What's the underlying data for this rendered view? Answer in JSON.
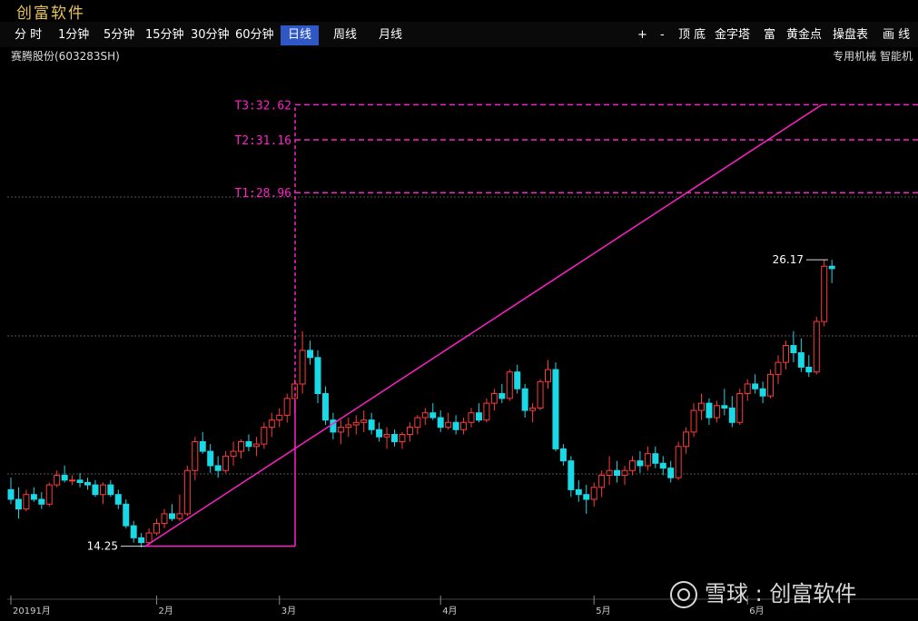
{
  "app": {
    "title": "创富软件"
  },
  "toolbar": {
    "periods": [
      "分 时",
      "1分钟",
      "5分钟",
      "15分钟",
      "30分钟",
      "60分钟",
      "日线",
      "周线",
      "月线"
    ],
    "active": "日线",
    "tools": [
      "+",
      "-",
      "顶 底",
      "金字塔",
      "富",
      "黄金点",
      "操盘表",
      "画 线"
    ]
  },
  "stock": {
    "name": "赛腾股份(603283SH)",
    "sector": "专用机械    智能机"
  },
  "colors": {
    "up": "#ff3b3b",
    "down": "#19d9e6",
    "target": "#ff20c8",
    "grid": "#555555"
  },
  "chart_data": {
    "type": "candlestick",
    "ylim": [
      12.8,
      33.2
    ],
    "low_label": "14.25",
    "last_label": "26.17",
    "targets": [
      {
        "label": "T3:32.62",
        "value": 32.62
      },
      {
        "label": "T2:31.16",
        "value": 31.16
      },
      {
        "label": "T1:28.96",
        "value": 28.96
      }
    ],
    "x_ticks": [
      {
        "label": "20191月",
        "index": 0
      },
      {
        "label": "2月",
        "index": 19
      },
      {
        "label": "3月",
        "index": 35
      },
      {
        "label": "4月",
        "index": 56
      },
      {
        "label": "5月",
        "index": 76
      },
      {
        "label": "6月",
        "index": 96
      }
    ],
    "ohlc": [
      [
        16.6,
        17.1,
        16.0,
        16.2
      ],
      [
        16.2,
        16.7,
        15.4,
        15.8
      ],
      [
        15.8,
        16.6,
        15.7,
        16.4
      ],
      [
        16.4,
        16.7,
        16.1,
        16.2
      ],
      [
        16.2,
        16.5,
        15.8,
        16.0
      ],
      [
        16.0,
        16.9,
        15.9,
        16.8
      ],
      [
        16.8,
        17.4,
        16.7,
        17.2
      ],
      [
        17.2,
        17.6,
        16.9,
        17.0
      ],
      [
        17.0,
        17.2,
        16.8,
        17.0
      ],
      [
        17.0,
        17.3,
        16.7,
        16.9
      ],
      [
        16.9,
        17.1,
        16.6,
        16.8
      ],
      [
        16.8,
        17.0,
        16.3,
        16.4
      ],
      [
        16.4,
        16.9,
        16.0,
        16.8
      ],
      [
        16.8,
        17.0,
        16.3,
        16.4
      ],
      [
        16.4,
        16.6,
        15.8,
        16.0
      ],
      [
        16.0,
        16.2,
        15.0,
        15.1
      ],
      [
        15.1,
        15.3,
        14.4,
        14.6
      ],
      [
        14.6,
        14.8,
        14.2,
        14.4
      ],
      [
        14.4,
        15.0,
        14.3,
        14.8
      ],
      [
        14.8,
        15.4,
        14.7,
        15.2
      ],
      [
        15.2,
        15.8,
        15.0,
        15.6
      ],
      [
        15.6,
        16.0,
        15.3,
        15.4
      ],
      [
        15.4,
        16.4,
        15.3,
        15.6
      ],
      [
        15.6,
        17.6,
        15.5,
        17.4
      ],
      [
        17.4,
        18.8,
        17.0,
        18.6
      ],
      [
        18.6,
        19.0,
        18.1,
        18.2
      ],
      [
        18.2,
        18.5,
        17.3,
        17.6
      ],
      [
        17.6,
        18.0,
        17.1,
        17.4
      ],
      [
        17.4,
        18.2,
        17.3,
        18.0
      ],
      [
        18.0,
        18.6,
        17.6,
        18.2
      ],
      [
        18.2,
        18.7,
        17.9,
        18.6
      ],
      [
        18.6,
        18.9,
        18.2,
        18.4
      ],
      [
        18.4,
        18.8,
        18.0,
        18.5
      ],
      [
        18.5,
        19.4,
        18.3,
        19.2
      ],
      [
        19.2,
        19.8,
        18.8,
        19.5
      ],
      [
        19.5,
        20.0,
        19.2,
        19.7
      ],
      [
        19.7,
        20.6,
        19.4,
        20.4
      ],
      [
        20.4,
        21.2,
        19.8,
        21.0
      ],
      [
        21.0,
        23.2,
        20.6,
        22.4
      ],
      [
        22.4,
        22.8,
        21.8,
        22.1
      ],
      [
        22.1,
        22.4,
        20.2,
        20.6
      ],
      [
        20.6,
        20.9,
        19.3,
        19.5
      ],
      [
        19.5,
        19.8,
        18.7,
        19.0
      ],
      [
        19.0,
        19.5,
        18.5,
        19.2
      ],
      [
        19.2,
        19.6,
        18.8,
        19.3
      ],
      [
        19.3,
        19.7,
        18.9,
        19.4
      ],
      [
        19.4,
        19.9,
        19.0,
        19.5
      ],
      [
        19.5,
        19.8,
        18.9,
        19.1
      ],
      [
        19.1,
        19.4,
        18.6,
        18.8
      ],
      [
        18.8,
        19.2,
        18.3,
        18.9
      ],
      [
        18.9,
        19.1,
        18.4,
        18.6
      ],
      [
        18.6,
        19.0,
        18.3,
        18.9
      ],
      [
        18.9,
        19.4,
        18.6,
        19.2
      ],
      [
        19.2,
        19.7,
        18.9,
        19.6
      ],
      [
        19.6,
        20.0,
        19.3,
        19.8
      ],
      [
        19.8,
        20.2,
        19.5,
        19.6
      ],
      [
        19.6,
        19.9,
        19.0,
        19.2
      ],
      [
        19.2,
        19.8,
        19.1,
        19.4
      ],
      [
        19.4,
        19.7,
        18.9,
        19.1
      ],
      [
        19.1,
        19.6,
        18.9,
        19.4
      ],
      [
        19.4,
        20.0,
        19.2,
        19.8
      ],
      [
        19.8,
        20.2,
        19.4,
        19.5
      ],
      [
        19.5,
        20.4,
        19.4,
        20.2
      ],
      [
        20.2,
        20.8,
        19.9,
        20.6
      ],
      [
        20.6,
        21.0,
        20.2,
        20.4
      ],
      [
        20.4,
        21.6,
        20.3,
        21.5
      ],
      [
        21.5,
        21.8,
        20.6,
        20.8
      ],
      [
        20.8,
        21.0,
        19.6,
        19.9
      ],
      [
        19.9,
        20.2,
        19.4,
        20.0
      ],
      [
        20.0,
        21.2,
        19.9,
        21.1
      ],
      [
        21.1,
        22.0,
        20.8,
        21.6
      ],
      [
        21.6,
        21.9,
        18.2,
        18.3
      ],
      [
        18.3,
        18.5,
        17.6,
        17.8
      ],
      [
        17.8,
        18.0,
        16.3,
        16.6
      ],
      [
        16.6,
        17.0,
        16.1,
        16.4
      ],
      [
        16.4,
        16.8,
        15.6,
        16.2
      ],
      [
        16.2,
        16.9,
        15.9,
        16.7
      ],
      [
        16.7,
        17.4,
        16.3,
        17.2
      ],
      [
        17.2,
        18.0,
        16.8,
        17.4
      ],
      [
        17.4,
        17.8,
        16.9,
        17.2
      ],
      [
        17.2,
        17.6,
        16.8,
        17.4
      ],
      [
        17.4,
        18.0,
        17.2,
        17.8
      ],
      [
        17.8,
        18.2,
        17.3,
        17.6
      ],
      [
        17.6,
        18.4,
        17.4,
        18.1
      ],
      [
        18.1,
        18.4,
        17.5,
        17.7
      ],
      [
        17.7,
        18.0,
        17.2,
        17.5
      ],
      [
        17.5,
        17.8,
        16.9,
        17.1
      ],
      [
        17.1,
        18.6,
        17.0,
        18.4
      ],
      [
        18.4,
        19.2,
        18.1,
        19.0
      ],
      [
        19.0,
        20.2,
        18.8,
        19.9
      ],
      [
        19.9,
        20.6,
        19.5,
        20.2
      ],
      [
        20.2,
        20.4,
        19.3,
        19.6
      ],
      [
        19.6,
        20.3,
        19.4,
        20.1
      ],
      [
        20.1,
        20.8,
        19.7,
        20.0
      ],
      [
        20.0,
        20.5,
        19.2,
        19.4
      ],
      [
        19.4,
        20.8,
        19.3,
        20.6
      ],
      [
        20.6,
        21.2,
        20.3,
        21.0
      ],
      [
        21.0,
        21.4,
        20.6,
        20.8
      ],
      [
        20.8,
        21.1,
        20.2,
        20.5
      ],
      [
        20.5,
        21.6,
        20.4,
        21.4
      ],
      [
        21.4,
        22.2,
        21.0,
        21.9
      ],
      [
        21.9,
        22.8,
        21.6,
        22.6
      ],
      [
        22.6,
        23.2,
        21.9,
        22.3
      ],
      [
        22.3,
        22.9,
        21.5,
        21.7
      ],
      [
        21.7,
        22.2,
        21.3,
        21.5
      ],
      [
        21.5,
        23.8,
        21.4,
        23.6
      ],
      [
        23.6,
        26.17,
        23.4,
        25.9
      ],
      [
        25.9,
        26.17,
        25.2,
        25.8
      ]
    ]
  }
}
